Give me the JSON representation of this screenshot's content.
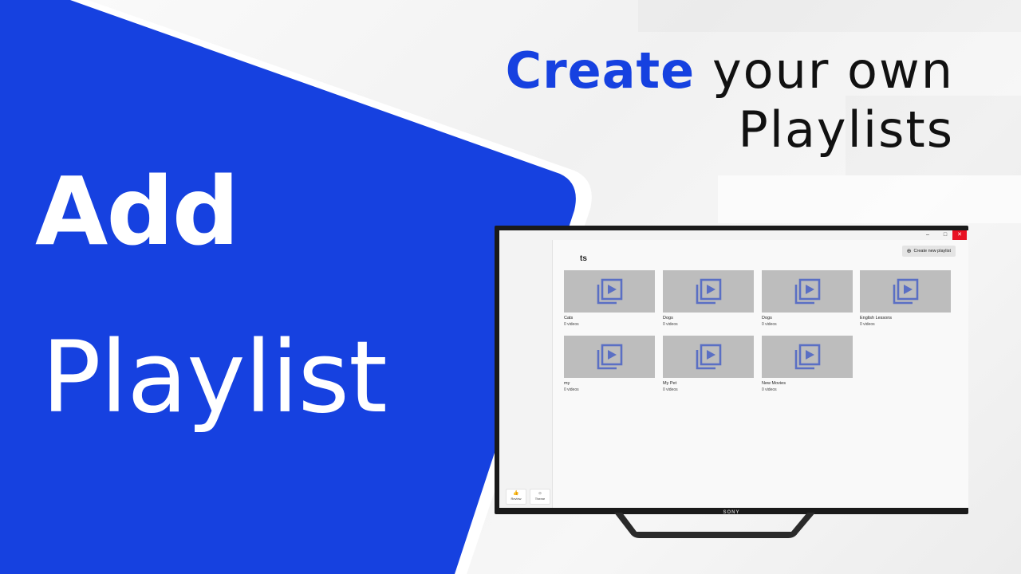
{
  "headline": {
    "accent": "Create",
    "rest_line1": " your own",
    "line2": "Playlists"
  },
  "banner": {
    "title_line1": "Add",
    "title_line2": "Playlist",
    "color": "#1641e0"
  },
  "app": {
    "page_title_visible": "ts",
    "create_button_label": "Create new playlist",
    "window_controls": [
      "–",
      "□",
      "✕"
    ],
    "playlists": [
      {
        "name": "Cats",
        "count": "0 videos"
      },
      {
        "name": "Dogs",
        "count": "0 videos"
      },
      {
        "name": "Dogs",
        "count": "0 videos"
      },
      {
        "name": "English Lessons",
        "count": "0 videos"
      },
      {
        "name": "my",
        "count": "0 videos"
      },
      {
        "name": "My Pet",
        "count": "0 videos"
      },
      {
        "name": "New Movies",
        "count": "0 videos"
      }
    ],
    "sidebar_buttons": [
      {
        "label": "Review",
        "icon": "thumbs-up-icon"
      },
      {
        "label": "Theme",
        "icon": "sun-icon"
      }
    ],
    "thumbnail_icon": "video-library-icon",
    "icon_color": "#5a6fc4"
  },
  "tv": {
    "brand": "SONY"
  }
}
